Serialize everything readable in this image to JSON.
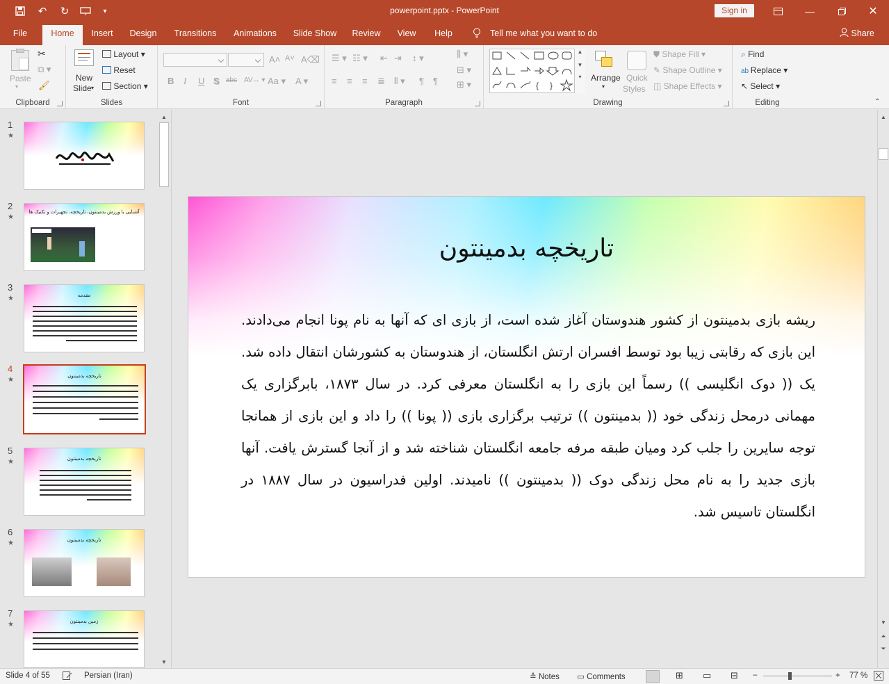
{
  "app": {
    "title": "powerpoint.pptx  -  PowerPoint",
    "sign_in": "Sign in"
  },
  "tabs": [
    {
      "label": "File"
    },
    {
      "label": "Home"
    },
    {
      "label": "Insert"
    },
    {
      "label": "Design"
    },
    {
      "label": "Transitions"
    },
    {
      "label": "Animations"
    },
    {
      "label": "Slide Show"
    },
    {
      "label": "Review"
    },
    {
      "label": "View"
    },
    {
      "label": "Help"
    }
  ],
  "tell_me": "Tell me what you want to do",
  "share": "Share",
  "ribbon": {
    "clipboard": {
      "label": "Clipboard",
      "paste": "Paste"
    },
    "slides": {
      "label": "Slides",
      "new_slide_1": "New",
      "new_slide_2": "Slide",
      "layout": "Layout",
      "reset": "Reset",
      "section": "Section"
    },
    "font": {
      "label": "Font",
      "bold": "B",
      "italic": "I",
      "underline": "U",
      "shadow": "S",
      "strike": "abc",
      "spacing": "AV",
      "case": "Aa",
      "grow": "A",
      "shrink": "A",
      "clear": "A",
      "color": "A"
    },
    "paragraph": {
      "label": "Paragraph"
    },
    "drawing": {
      "label": "Drawing",
      "arrange": "Arrange",
      "quick_styles_1": "Quick",
      "quick_styles_2": "Styles",
      "shape_fill": "Shape Fill",
      "shape_outline": "Shape Outline",
      "shape_effects": "Shape Effects"
    },
    "editing": {
      "label": "Editing",
      "find": "Find",
      "replace": "Replace",
      "select": "Select"
    }
  },
  "thumbnails": [
    {
      "num": "1",
      "title": ""
    },
    {
      "num": "2",
      "title": "آشنایی با ورزش بدمینتون، تاریخچه، تجهیزات و تکنیک ها"
    },
    {
      "num": "3",
      "title": "مقدمه"
    },
    {
      "num": "4",
      "title": "تاریخچه بدمینتون"
    },
    {
      "num": "5",
      "title": "تاریخچه بدمینتون"
    },
    {
      "num": "6",
      "title": "تاریخچه بدمینتون"
    },
    {
      "num": "7",
      "title": "زمین بدمینتون"
    }
  ],
  "slide": {
    "title": "تاریخچه بدمینتون",
    "body": "ریشه بازی بدمینتون از کشور هندوستان آغاز شده است، از بازی ای که آنها به نام پونا انجام می‌دادند. این بازی که رقابتی زیبا بود توسط افسران ارتش انگلستان، از هندوستان به کشورشان انتقال داده شد. یک (( دوک انگلیسی )) رسماً این بازی را به انگلستان معرفی کرد. در سال ۱۸۷۳، بابرگزاری یک مهمانی درمحل زندگی خود (( بدمینتون )) ترتیب برگزاری بازی (( پونا )) را داد و این بازی از همانجا توجه سایرین را جلب کرد ومیان طبقه مرفه جامعه انگلستان شناخته شد و از آنجا گسترش یافت. آنها بازی جدید را به  نام محل زندگی دوک (( بدمینتون )) نامیدند. اولین فدراسیون در سال ۱۸۸۷ در انگلستان تاسیس شد."
  },
  "status": {
    "slide_info": "Slide 4 of 55",
    "language": "Persian (Iran)",
    "notes": "Notes",
    "comments": "Comments",
    "zoom": "77 %"
  }
}
